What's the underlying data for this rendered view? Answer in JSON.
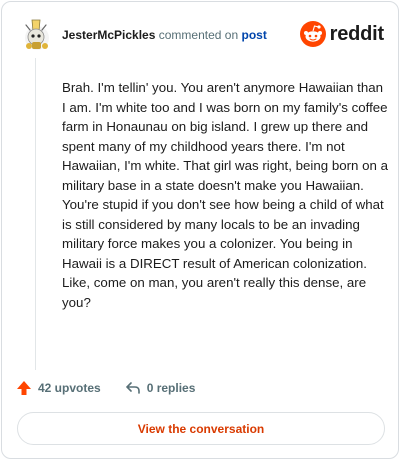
{
  "header": {
    "author": "JesterMcPickles",
    "action_text": "commented on",
    "post_link": "post",
    "brand": "reddit"
  },
  "comment": {
    "body": "Brah. I'm tellin' you. You aren't anymore Hawaiian than I am. I'm white too and I was born on my family's coffee farm in Honaunau on big island. I grew up there and spent many of my childhood years there. I'm not Hawaiian, I'm white. That girl was right, being born on a military base in a state doesn't make you Hawaiian. You're stupid if you don't see how being a child of what is still considered by many locals to be an invading military force makes you a colonizer. You being in Hawaii is a DIRECT result of American colonization. Like, come on man, you aren't really this dense, are you?"
  },
  "stats": {
    "upvotes": "42 upvotes",
    "replies": "0 replies"
  },
  "cta": {
    "label": "View the conversation"
  },
  "colors": {
    "accent": "#d93a00",
    "upvote": "#ff4500",
    "link": "#0045ac",
    "muted": "#576f76"
  },
  "icons": {
    "avatar": "user-avatar",
    "brand": "reddit-logo-icon",
    "upvote": "upvote-arrow-icon",
    "reply": "reply-arrow-icon"
  }
}
